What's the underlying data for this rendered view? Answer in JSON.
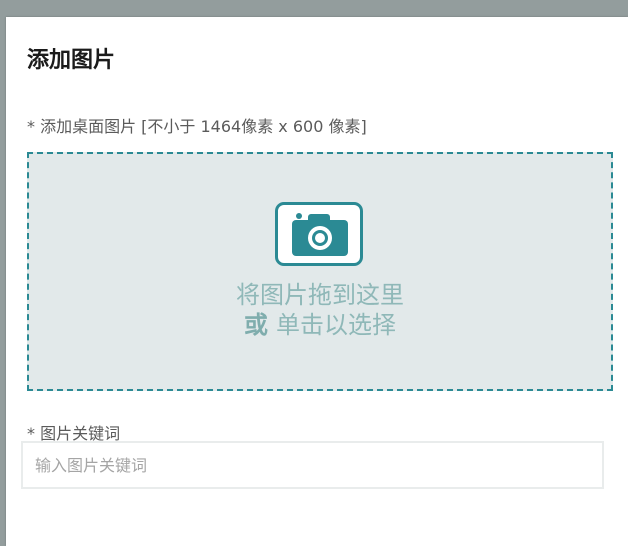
{
  "dialog": {
    "title": "添加图片"
  },
  "desktop_image": {
    "label": "* 添加桌面图片 [不小于 1464像素 x 600 像素]",
    "dropzone": {
      "icon": "camera-icon",
      "line1": "将图片拖到这里",
      "or_word": "或",
      "click_text": "单击以选择"
    }
  },
  "keywords": {
    "label": "* 图片关键词",
    "placeholder": "输入图片关键词",
    "value": ""
  },
  "colors": {
    "accent": "#2b8a94",
    "dropzone_bg": "#e2e9ea",
    "drop_text": "#8fb8b8",
    "backdrop": "#939d9d"
  }
}
